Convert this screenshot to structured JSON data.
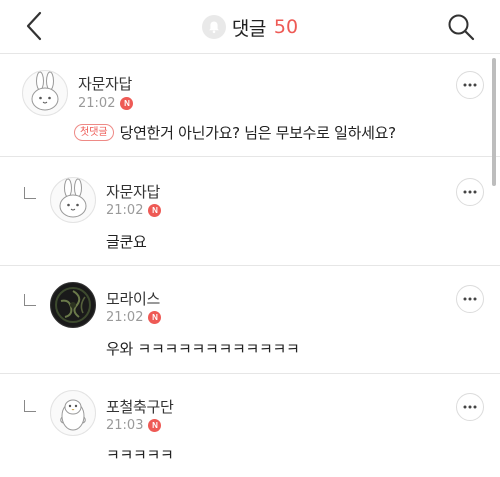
{
  "header": {
    "title": "댓글",
    "count": "50",
    "back_icon": "chevron-left-icon",
    "bell_icon": "bell-icon",
    "search_icon": "search-icon"
  },
  "comments": [
    {
      "author": "자문자답",
      "time": "21:02",
      "new_badge": "N",
      "first_badge": "첫댓글",
      "text": "당연한거 아닌가요? 님은 무보수로 일하세요?",
      "avatar": "rabbit-avatar",
      "is_reply": false
    },
    {
      "author": "자문자답",
      "time": "21:02",
      "new_badge": "N",
      "text": "글쿤요",
      "avatar": "rabbit-avatar",
      "is_reply": true
    },
    {
      "author": "모라이스",
      "time": "21:02",
      "new_badge": "N",
      "text": "우와 ㅋㅋㅋㅋㅋㅋㅋㅋㅋㅋㅋㅋ",
      "avatar": "dark-swirl-avatar",
      "is_reply": true
    },
    {
      "author": "포철축구단",
      "time": "21:03",
      "new_badge": "N",
      "text": "ㅋㅋㅋㅋㅋ",
      "avatar": "penguin-avatar",
      "is_reply": true
    }
  ],
  "colors": {
    "accent": "#ee5a55",
    "divider": "#e6e6e6",
    "muted": "#9a9a9a"
  }
}
